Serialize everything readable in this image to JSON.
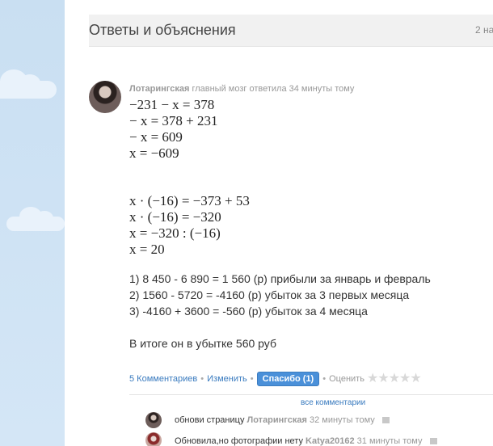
{
  "header": {
    "title": "Ответы и объяснения",
    "count": "2 на"
  },
  "answer": {
    "author": "Лотарингская",
    "rank": "главный мозг",
    "answered": "ответила 34 минуты тому",
    "math1": [
      "−231 − x = 378",
      "− x = 378 + 231",
      "− x = 609",
      "x = −609"
    ],
    "math2": [
      "x · (−16) = −373 + 53",
      "x · (−16) = −320",
      "x = −320 : (−16)",
      "x = 20"
    ],
    "lines": [
      "1) 8 450 - 6 890 =  1 560 (р) прибыли за январь и февраль",
      "2) 1560 - 5720 = -4160 (р) убыток за 3 первых месяца",
      "3) -4160 + 3600 = -560 (р) убыток за 4 месяца"
    ],
    "conclusion": "В итоге он в убытке 560 руб"
  },
  "actions": {
    "comments": "5 Комментариев",
    "edit": "Изменить",
    "thanks": "Спасибо (1)",
    "rate": "Оценить",
    "stars": "★★★★★"
  },
  "comments": {
    "all": "все комментарии",
    "items": [
      {
        "text": "обнови страницу",
        "author": "Лотарингская",
        "time": "32 минуты тому"
      },
      {
        "text": "Обновила,но фотографии нету",
        "author": "Katya20162",
        "time": "31 минуты тому"
      }
    ]
  }
}
